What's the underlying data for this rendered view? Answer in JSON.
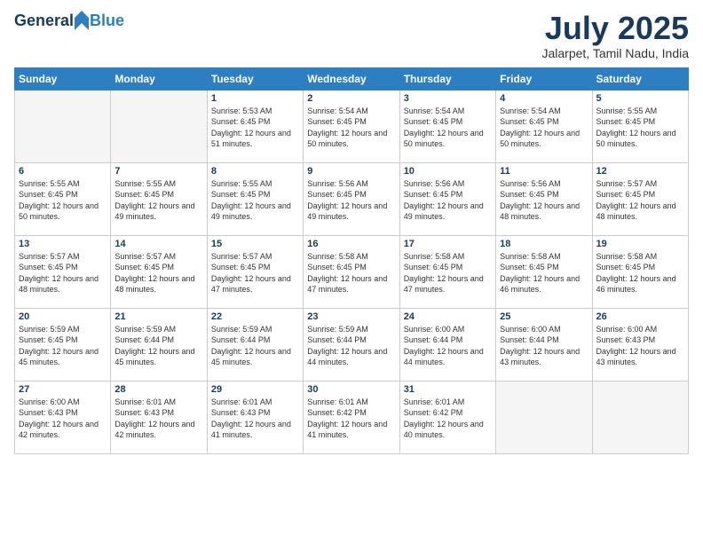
{
  "header": {
    "logo_general": "General",
    "logo_blue": "Blue",
    "month_title": "July 2025",
    "location": "Jalarpet, Tamil Nadu, India"
  },
  "weekdays": [
    "Sunday",
    "Monday",
    "Tuesday",
    "Wednesday",
    "Thursday",
    "Friday",
    "Saturday"
  ],
  "weeks": [
    [
      {
        "day": "",
        "empty": true
      },
      {
        "day": "",
        "empty": true
      },
      {
        "day": "1",
        "sunrise": "5:53 AM",
        "sunset": "6:45 PM",
        "daylight": "12 hours and 51 minutes."
      },
      {
        "day": "2",
        "sunrise": "5:54 AM",
        "sunset": "6:45 PM",
        "daylight": "12 hours and 50 minutes."
      },
      {
        "day": "3",
        "sunrise": "5:54 AM",
        "sunset": "6:45 PM",
        "daylight": "12 hours and 50 minutes."
      },
      {
        "day": "4",
        "sunrise": "5:54 AM",
        "sunset": "6:45 PM",
        "daylight": "12 hours and 50 minutes."
      },
      {
        "day": "5",
        "sunrise": "5:55 AM",
        "sunset": "6:45 PM",
        "daylight": "12 hours and 50 minutes."
      }
    ],
    [
      {
        "day": "6",
        "sunrise": "5:55 AM",
        "sunset": "6:45 PM",
        "daylight": "12 hours and 50 minutes."
      },
      {
        "day": "7",
        "sunrise": "5:55 AM",
        "sunset": "6:45 PM",
        "daylight": "12 hours and 49 minutes."
      },
      {
        "day": "8",
        "sunrise": "5:55 AM",
        "sunset": "6:45 PM",
        "daylight": "12 hours and 49 minutes."
      },
      {
        "day": "9",
        "sunrise": "5:56 AM",
        "sunset": "6:45 PM",
        "daylight": "12 hours and 49 minutes."
      },
      {
        "day": "10",
        "sunrise": "5:56 AM",
        "sunset": "6:45 PM",
        "daylight": "12 hours and 49 minutes."
      },
      {
        "day": "11",
        "sunrise": "5:56 AM",
        "sunset": "6:45 PM",
        "daylight": "12 hours and 48 minutes."
      },
      {
        "day": "12",
        "sunrise": "5:57 AM",
        "sunset": "6:45 PM",
        "daylight": "12 hours and 48 minutes."
      }
    ],
    [
      {
        "day": "13",
        "sunrise": "5:57 AM",
        "sunset": "6:45 PM",
        "daylight": "12 hours and 48 minutes."
      },
      {
        "day": "14",
        "sunrise": "5:57 AM",
        "sunset": "6:45 PM",
        "daylight": "12 hours and 48 minutes."
      },
      {
        "day": "15",
        "sunrise": "5:57 AM",
        "sunset": "6:45 PM",
        "daylight": "12 hours and 47 minutes."
      },
      {
        "day": "16",
        "sunrise": "5:58 AM",
        "sunset": "6:45 PM",
        "daylight": "12 hours and 47 minutes."
      },
      {
        "day": "17",
        "sunrise": "5:58 AM",
        "sunset": "6:45 PM",
        "daylight": "12 hours and 47 minutes."
      },
      {
        "day": "18",
        "sunrise": "5:58 AM",
        "sunset": "6:45 PM",
        "daylight": "12 hours and 46 minutes."
      },
      {
        "day": "19",
        "sunrise": "5:58 AM",
        "sunset": "6:45 PM",
        "daylight": "12 hours and 46 minutes."
      }
    ],
    [
      {
        "day": "20",
        "sunrise": "5:59 AM",
        "sunset": "6:45 PM",
        "daylight": "12 hours and 45 minutes."
      },
      {
        "day": "21",
        "sunrise": "5:59 AM",
        "sunset": "6:44 PM",
        "daylight": "12 hours and 45 minutes."
      },
      {
        "day": "22",
        "sunrise": "5:59 AM",
        "sunset": "6:44 PM",
        "daylight": "12 hours and 45 minutes."
      },
      {
        "day": "23",
        "sunrise": "5:59 AM",
        "sunset": "6:44 PM",
        "daylight": "12 hours and 44 minutes."
      },
      {
        "day": "24",
        "sunrise": "6:00 AM",
        "sunset": "6:44 PM",
        "daylight": "12 hours and 44 minutes."
      },
      {
        "day": "25",
        "sunrise": "6:00 AM",
        "sunset": "6:44 PM",
        "daylight": "12 hours and 43 minutes."
      },
      {
        "day": "26",
        "sunrise": "6:00 AM",
        "sunset": "6:43 PM",
        "daylight": "12 hours and 43 minutes."
      }
    ],
    [
      {
        "day": "27",
        "sunrise": "6:00 AM",
        "sunset": "6:43 PM",
        "daylight": "12 hours and 42 minutes."
      },
      {
        "day": "28",
        "sunrise": "6:01 AM",
        "sunset": "6:43 PM",
        "daylight": "12 hours and 42 minutes."
      },
      {
        "day": "29",
        "sunrise": "6:01 AM",
        "sunset": "6:43 PM",
        "daylight": "12 hours and 41 minutes."
      },
      {
        "day": "30",
        "sunrise": "6:01 AM",
        "sunset": "6:42 PM",
        "daylight": "12 hours and 41 minutes."
      },
      {
        "day": "31",
        "sunrise": "6:01 AM",
        "sunset": "6:42 PM",
        "daylight": "12 hours and 40 minutes."
      },
      {
        "day": "",
        "empty": true
      },
      {
        "day": "",
        "empty": true
      }
    ]
  ]
}
